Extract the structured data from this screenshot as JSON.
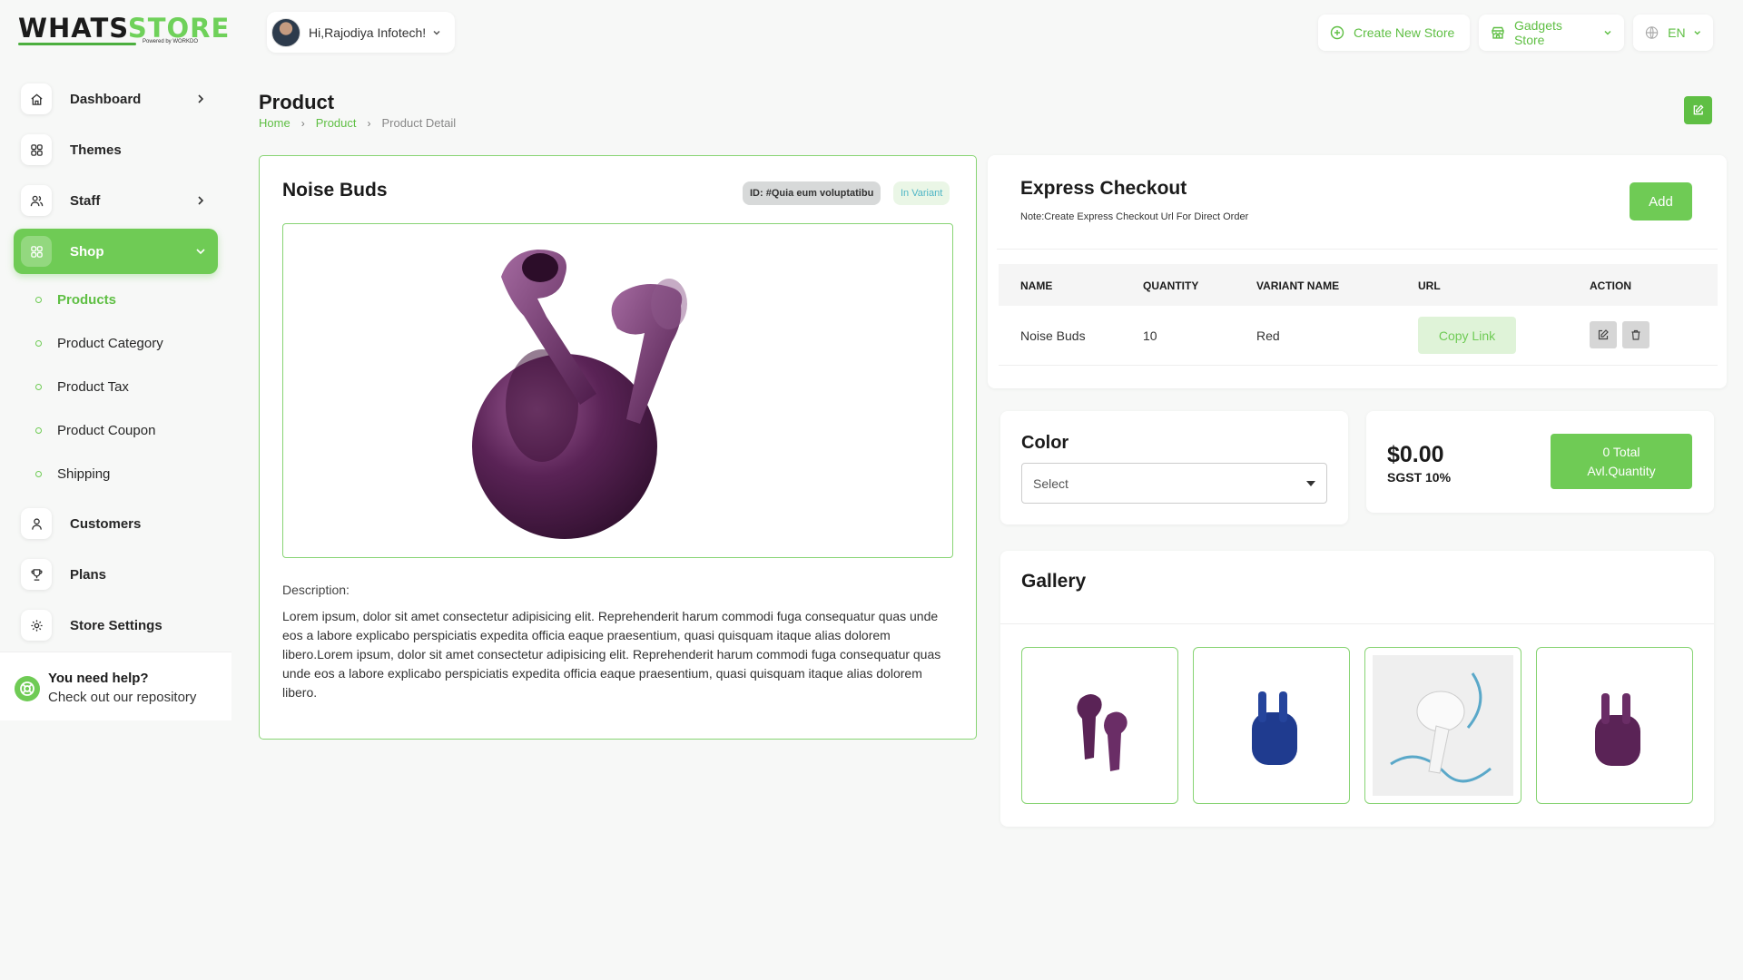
{
  "brand": {
    "logo_part1": "WHATS",
    "logo_part2": "STORE",
    "logo_sub": "Powered by WORKDO"
  },
  "sidebar": {
    "items": [
      {
        "label": "Dashboard",
        "icon": "home-icon"
      },
      {
        "label": "Themes",
        "icon": "grid-icon"
      },
      {
        "label": "Staff",
        "icon": "users-icon"
      },
      {
        "label": "Shop",
        "icon": "grid-icon"
      }
    ],
    "shop_sub": [
      {
        "label": "Products"
      },
      {
        "label": "Product Category"
      },
      {
        "label": "Product Tax"
      },
      {
        "label": "Product Coupon"
      },
      {
        "label": "Shipping"
      }
    ],
    "items_after": [
      {
        "label": "Customers",
        "icon": "user-icon"
      },
      {
        "label": "Plans",
        "icon": "trophy-icon"
      },
      {
        "label": "Store Settings",
        "icon": "gear-icon"
      }
    ],
    "help_title": "You need help?",
    "help_sub": "Check out our repository"
  },
  "topbar": {
    "greeting": "Hi,Rajodiya Infotech!",
    "create_store": "Create New Store",
    "store_name": "Gadgets Store",
    "language": "EN"
  },
  "header": {
    "title": "Product",
    "breadcrumb": [
      "Home",
      "Product",
      "Product Detail"
    ]
  },
  "product": {
    "name": "Noise Buds",
    "id_badge": "ID: #Quia eum voluptatibu",
    "variant_badge": "In Variant",
    "description_label": "Description:",
    "description": "Lorem ipsum, dolor sit amet consectetur adipisicing elit. Reprehenderit harum commodi fuga consequatur quas unde eos a labore explicabo perspiciatis expedita officia eaque praesentium, quasi quisquam itaque alias dolorem libero.Lorem ipsum, dolor sit amet consectetur adipisicing elit. Reprehenderit harum commodi fuga consequatur quas unde eos a labore explicabo perspiciatis expedita officia eaque praesentium, quasi quisquam itaque alias dolorem libero."
  },
  "express": {
    "title": "Express Checkout",
    "note": "Note:Create Express Checkout Url For Direct Order",
    "add_label": "Add",
    "columns": [
      "NAME",
      "QUANTITY",
      "VARIANT NAME",
      "URL",
      "ACTION"
    ],
    "rows": [
      {
        "name": "Noise Buds",
        "quantity": "10",
        "variant": "Red",
        "url_label": "Copy Link"
      }
    ]
  },
  "color": {
    "label": "Color",
    "selected": "Select"
  },
  "pricing": {
    "price": "$0.00",
    "tax": "SGST 10%",
    "qty_line1": "0 Total",
    "qty_line2": "Avl.Quantity"
  },
  "gallery": {
    "title": "Gallery",
    "images": [
      "purple-earbuds",
      "blue-earbuds-case",
      "white-earbud-water-splash",
      "purple-earbuds-case"
    ]
  },
  "colors": {
    "accent": "#6fcb55",
    "accent_light": "#dff3d8",
    "product_purple": "#5a2356"
  }
}
